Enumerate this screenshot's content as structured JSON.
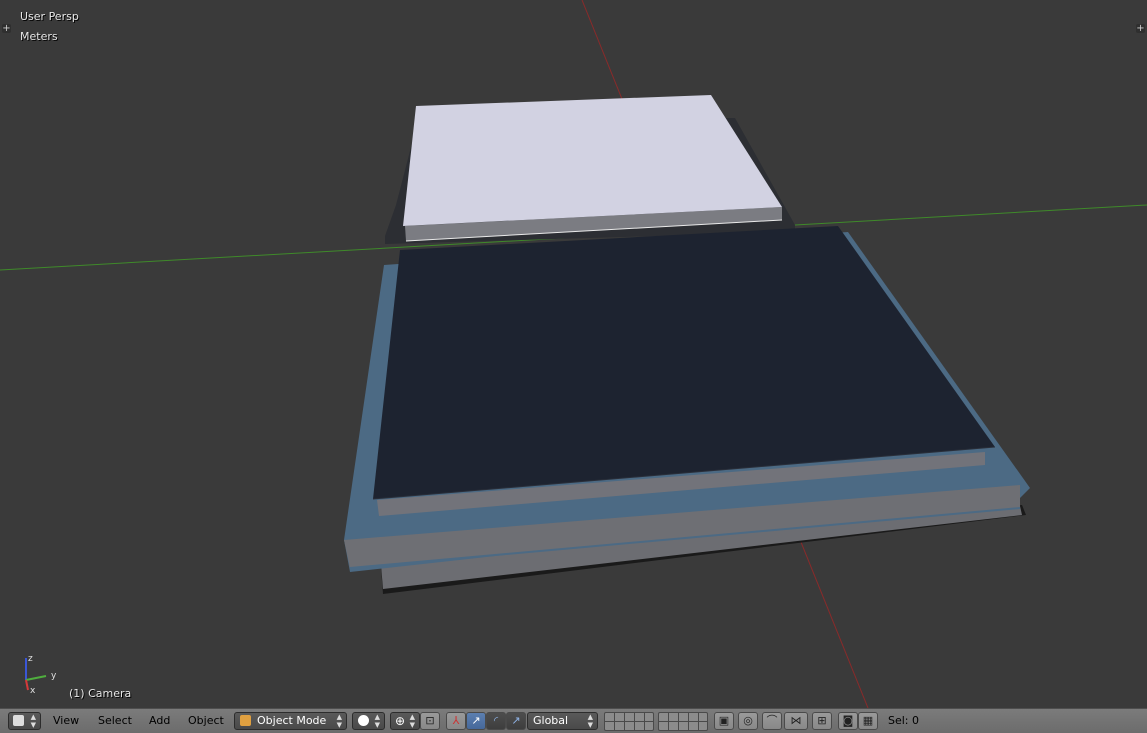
{
  "viewport": {
    "view_name": "User Persp",
    "units": "Meters",
    "active_object": "(1) Camera",
    "axis_labels": {
      "z": "z",
      "y": "y",
      "x": "x"
    }
  },
  "header": {
    "editor_type_icon": "3d-view-cube-icon",
    "menus": [
      "View",
      "Select",
      "Add",
      "Object"
    ],
    "mode": "Object Mode",
    "shading_icon": "solid-sphere-icon",
    "pivot_icon": "pivot-point-icon",
    "orientation": "Global",
    "selection_info": "Sel: 0"
  },
  "colors": {
    "viewport_bg": "#3a3a3a",
    "x_axis": "#8a2a2a",
    "y_axis": "#3f8a2a",
    "light_plane": "#d2d2e2",
    "dark_plane": "#1d2330",
    "blue_frame": "#4c6a84",
    "toolbar_bg": "#727272"
  }
}
